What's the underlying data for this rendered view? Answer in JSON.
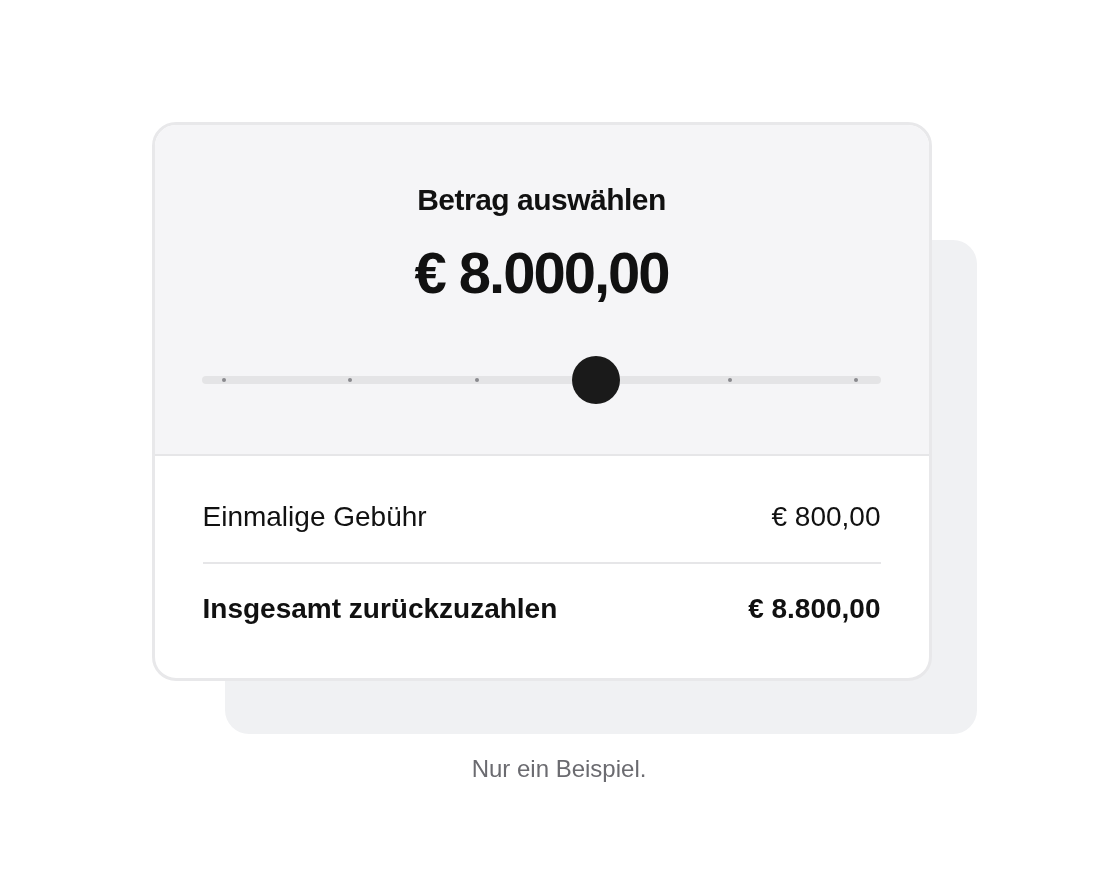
{
  "card": {
    "title": "Betrag auswählen",
    "amount": "€ 8.000,00",
    "slider": {
      "level": 0.58
    },
    "rows": [
      {
        "label": "Einmalige Gebühr",
        "value": "€ 800,00",
        "kind": "normal"
      },
      {
        "label": "Insgesamt zurückzuzahlen",
        "value": "€ 8.800,00",
        "kind": "total"
      }
    ]
  },
  "caption": "Nur ein Beispiel."
}
